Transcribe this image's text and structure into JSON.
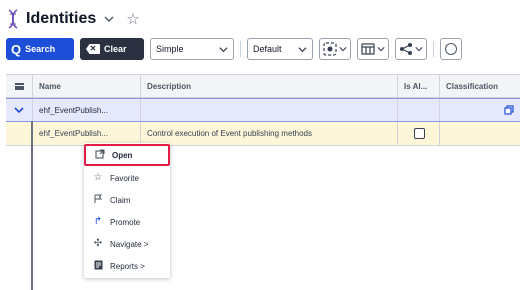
{
  "header": {
    "title": "Identities",
    "favorite_icon": "star-outline-icon"
  },
  "toolbar": {
    "search_label": "Search",
    "clear_label": "Clear",
    "mode_select": "Simple",
    "view_select": "Default"
  },
  "grid": {
    "columns": [
      "Name",
      "Description",
      "Is Al...",
      "Classification"
    ],
    "rows": [
      {
        "name": "ehf_EventPublish...",
        "description": "",
        "is_al": "",
        "classification": ""
      },
      {
        "name": "ehf_EventPublish...",
        "description": "Control execution of Event publishing methods",
        "is_al": "",
        "classification": ""
      }
    ]
  },
  "context_menu": {
    "items": [
      {
        "label": "Open",
        "icon": "open-window-icon"
      },
      {
        "label": "Favorite",
        "icon": "star-icon"
      },
      {
        "label": "Claim",
        "icon": "flag-icon"
      },
      {
        "label": "Promote",
        "icon": "promote-icon"
      },
      {
        "label": "Navigate >",
        "icon": "navigate-icon"
      },
      {
        "label": "Reports >",
        "icon": "reports-icon"
      }
    ]
  },
  "colors": {
    "search_button": "#1d4ed8",
    "clear_button": "#2b3141",
    "selected_row": "#e6e9fb",
    "hover_row": "#fdf6d8",
    "highlight_border": "#e11d48"
  }
}
